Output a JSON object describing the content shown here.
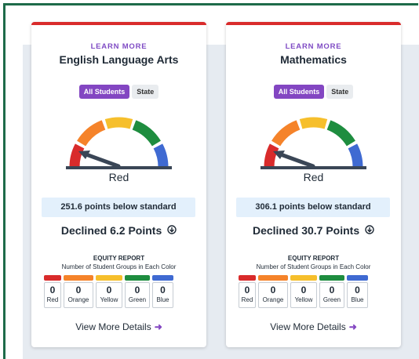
{
  "cards": [
    {
      "learn_more": "LEARN MORE",
      "subject": "English Language Arts",
      "toggle": {
        "all_students": "All Students",
        "state": "State"
      },
      "status": "Red",
      "gauge_level": "Red",
      "points": "251.6 points below standard",
      "declined": "Declined 6.2 Points",
      "equity": {
        "title": "EQUITY REPORT",
        "subtitle": "Number of Student Groups in Each Color",
        "groups": [
          {
            "label": "Red",
            "count": "0",
            "color": "#d92b2b"
          },
          {
            "label": "Orange",
            "count": "0",
            "color": "#f5832a"
          },
          {
            "label": "Yellow",
            "count": "0",
            "color": "#f6bf2c"
          },
          {
            "label": "Green",
            "count": "0",
            "color": "#1e8d3f"
          },
          {
            "label": "Blue",
            "count": "0",
            "color": "#3f6ad2"
          }
        ]
      },
      "view_more": "View More Details"
    },
    {
      "learn_more": "LEARN MORE",
      "subject": "Mathematics",
      "toggle": {
        "all_students": "All Students",
        "state": "State"
      },
      "status": "Red",
      "gauge_level": "Red",
      "points": "306.1 points below standard",
      "declined": "Declined 30.7 Points",
      "equity": {
        "title": "EQUITY REPORT",
        "subtitle": "Number of Student Groups in Each Color",
        "groups": [
          {
            "label": "Red",
            "count": "0",
            "color": "#d92b2b"
          },
          {
            "label": "Orange",
            "count": "0",
            "color": "#f5832a"
          },
          {
            "label": "Yellow",
            "count": "0",
            "color": "#f6bf2c"
          },
          {
            "label": "Green",
            "count": "0",
            "color": "#1e8d3f"
          },
          {
            "label": "Blue",
            "count": "0",
            "color": "#3f6ad2"
          }
        ]
      },
      "view_more": "View More Details"
    }
  ],
  "colors": {
    "frame": "#1e6b4a",
    "accent": "#8346c2",
    "card_top": "#d92b2b",
    "points_bg": "#e3f0fc"
  },
  "icons": {
    "declined": "circle-arrow-down-icon",
    "view_more": "arrow-right-icon"
  }
}
